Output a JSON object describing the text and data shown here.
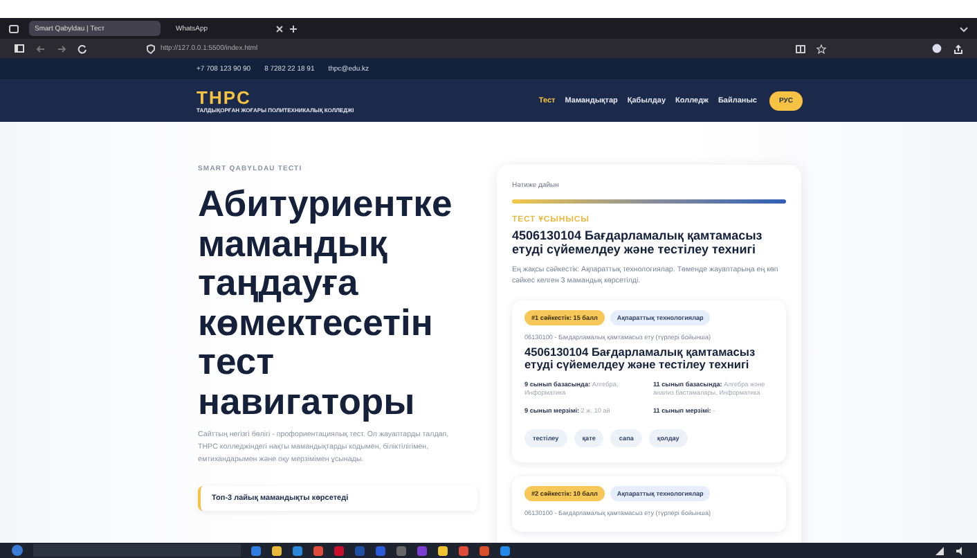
{
  "browser": {
    "tabs": [
      {
        "label": "Smart Qabyldau | Тест",
        "selected": true
      },
      {
        "label": "WhatsApp",
        "selected": false
      }
    ],
    "url": "http://127.0.0.1:5500/index.html"
  },
  "topbar": {
    "contacts": [
      "+7 708 123 90 90",
      "8 7282 22 18 91",
      "thpc@edu.kz"
    ]
  },
  "header": {
    "logo": "THPC",
    "subtitle": "ТАЛДЫҚОРҒАН ЖОҒАРЫ ПОЛИТЕХНИКАЛЫҚ КОЛЛЕДЖІ",
    "nav": [
      {
        "label": "Тест",
        "selected": true
      },
      {
        "label": "Мамандықтар",
        "selected": false
      },
      {
        "label": "Қабылдау",
        "selected": false
      },
      {
        "label": "Колледж",
        "selected": false
      },
      {
        "label": "Байланыс",
        "selected": false
      }
    ],
    "language": "РУС"
  },
  "hero": {
    "eyebrow": "SMART QABYLDAU ТЕСТІ",
    "title": "Абитуриентке мамандық таңдауға көмектесетін тест навигаторы",
    "description": "Сайттың негізгі бөлігі - профориентациялық тест. Ол жауаптарды талдап, THPC колледжіндегі нақты мамандықтарды кодымен, біліктілігімен, емтихандарымен және оқу мерзімімен ұсынады.",
    "features": [
      "Топ-3 лайық мамандықты көрсетеді"
    ]
  },
  "result": {
    "status": "Нәтиже дайын",
    "label": "ТЕСТ ҰСЫНЫСЫ",
    "title": "4506130104 Бағдарламалық қамтамасыз етуді сүйемелдеу және тестілеу технигі",
    "description": "Ең жақсы сәйкестік: Ақпараттық технологиялар. Төменде жауаптарыңа ең көп сәйкес келген 3 мамандық көрсетілді.",
    "recommendations": [
      {
        "score": "#1 сәйкестік: 15 балл",
        "area": "Ақпараттық технологиялар",
        "specialty": "06130100 - Бағдарламалық қамтамасыз ету (түрлері бойынша)",
        "title": "4506130104 Бағдарламалық қамтамасыз етуді сүйемелдеу және тестілеу технигі",
        "details": [
          {
            "label": "9 сынып базасында:",
            "value": "Алгебра, Информатика"
          },
          {
            "label": "11 сынып базасында:",
            "value": "Алгебра және анализ бастамалары, Информатика"
          },
          {
            "label": "9 сынып мерзімі:",
            "value": "2 ж. 10 ай"
          },
          {
            "label": "11 сынып мерзімі:",
            "value": "-"
          }
        ],
        "tags": [
          "тестілеу",
          "қате",
          "сапа",
          "қолдау"
        ]
      },
      {
        "score": "#2 сәйкестік: 10 балл",
        "area": "Ақпараттық технологиялар",
        "specialty": "06130100 - Бағдарламалық қамтамасыз ету (түрлері бойынша)"
      }
    ]
  }
}
